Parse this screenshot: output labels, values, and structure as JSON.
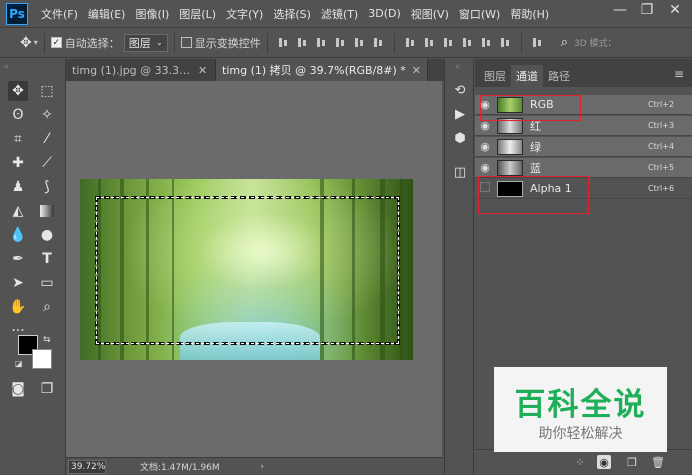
{
  "app": {
    "logo": "Ps"
  },
  "menu": [
    "文件(F)",
    "编辑(E)",
    "图像(I)",
    "图层(L)",
    "文字(Y)",
    "选择(S)",
    "滤镜(T)",
    "3D(D)",
    "视图(V)",
    "窗口(W)",
    "帮助(H)"
  ],
  "window_controls": {
    "minimize": "—",
    "maximize": "❐",
    "close": "✕"
  },
  "options": {
    "move_icon": "move-icon",
    "auto_select_label": "自动选择：",
    "auto_select_checked": true,
    "auto_select_target": "图层",
    "transform_controls_label": "显示变换控件",
    "transform_controls_checked": false,
    "mode_3d_label": "3D 模式："
  },
  "doc_tabs": [
    {
      "label": "timg (1).jpg @ 33.3%(R...",
      "close": "✕",
      "active": false
    },
    {
      "label": "timg (1) 拷贝 @ 39.7%(RGB/8#) *",
      "close": "✕",
      "active": true
    }
  ],
  "status": {
    "zoom": "39.72%",
    "doc_info": "文档:1.47M/1.96M",
    "arrow": "›"
  },
  "panel": {
    "tabs": [
      "图层",
      "通道",
      "路径"
    ],
    "active_tab": "通道",
    "menu_icon": "≡",
    "channels": [
      {
        "name": "RGB",
        "shortcut": "Ctrl+2",
        "visible": true,
        "selected": true
      },
      {
        "name": "红",
        "shortcut": "Ctrl+3",
        "visible": true,
        "selected": true
      },
      {
        "name": "绿",
        "shortcut": "Ctrl+4",
        "visible": true,
        "selected": true
      },
      {
        "name": "蓝",
        "shortcut": "Ctrl+5",
        "visible": true,
        "selected": true
      },
      {
        "name": "Alpha 1",
        "shortcut": "Ctrl+6",
        "visible": false,
        "selected": false
      }
    ]
  },
  "watermark": {
    "title": "百科全说",
    "subtitle": "助你轻松解决"
  },
  "colors": {
    "highlight": "#e0242f",
    "watermark_green": "#1faf5b",
    "foreground": "#000000",
    "background": "#ffffff"
  }
}
